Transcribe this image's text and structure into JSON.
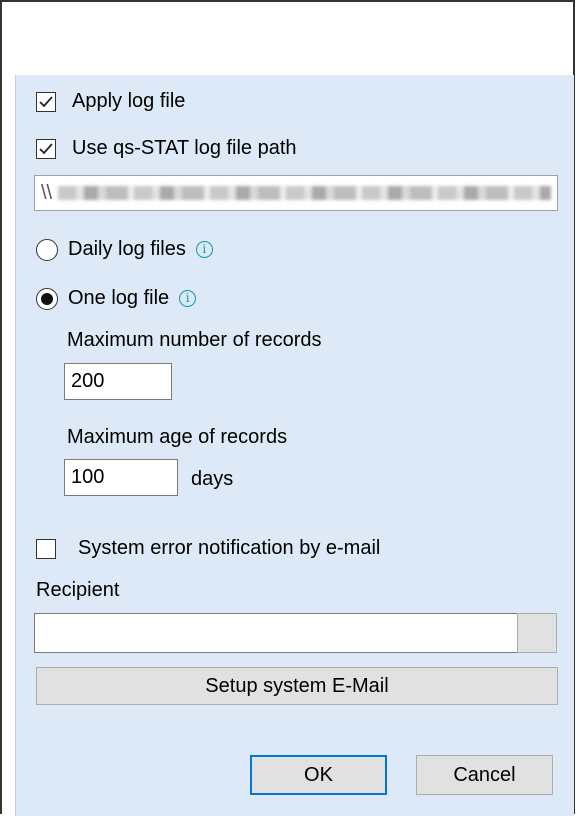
{
  "options": {
    "apply_log_file": {
      "label": "Apply log file",
      "checked": true
    },
    "use_path": {
      "label": "Use qs-STAT log file path",
      "checked": true
    },
    "path_prefix": "\\\\",
    "daily_log_files": {
      "label": "Daily log files",
      "selected": false
    },
    "one_log_file": {
      "label": "One log file",
      "selected": true
    },
    "max_records_label": "Maximum number of records",
    "max_records_value": "200",
    "max_age_label": "Maximum age of records",
    "max_age_value": "100",
    "days_label": "days"
  },
  "email": {
    "notification": {
      "label": "System error notification by e-mail",
      "checked": false
    },
    "recipient_label": "Recipient",
    "recipient_value": "",
    "setup_button": "Setup system E-Mail"
  },
  "buttons": {
    "ok": "OK",
    "cancel": "Cancel"
  },
  "icons": {
    "check": "check-icon",
    "info": "info-icon"
  },
  "colors": {
    "panel": "#dde9f7",
    "info": "#0a9ab3",
    "default_border": "#0078d7"
  }
}
